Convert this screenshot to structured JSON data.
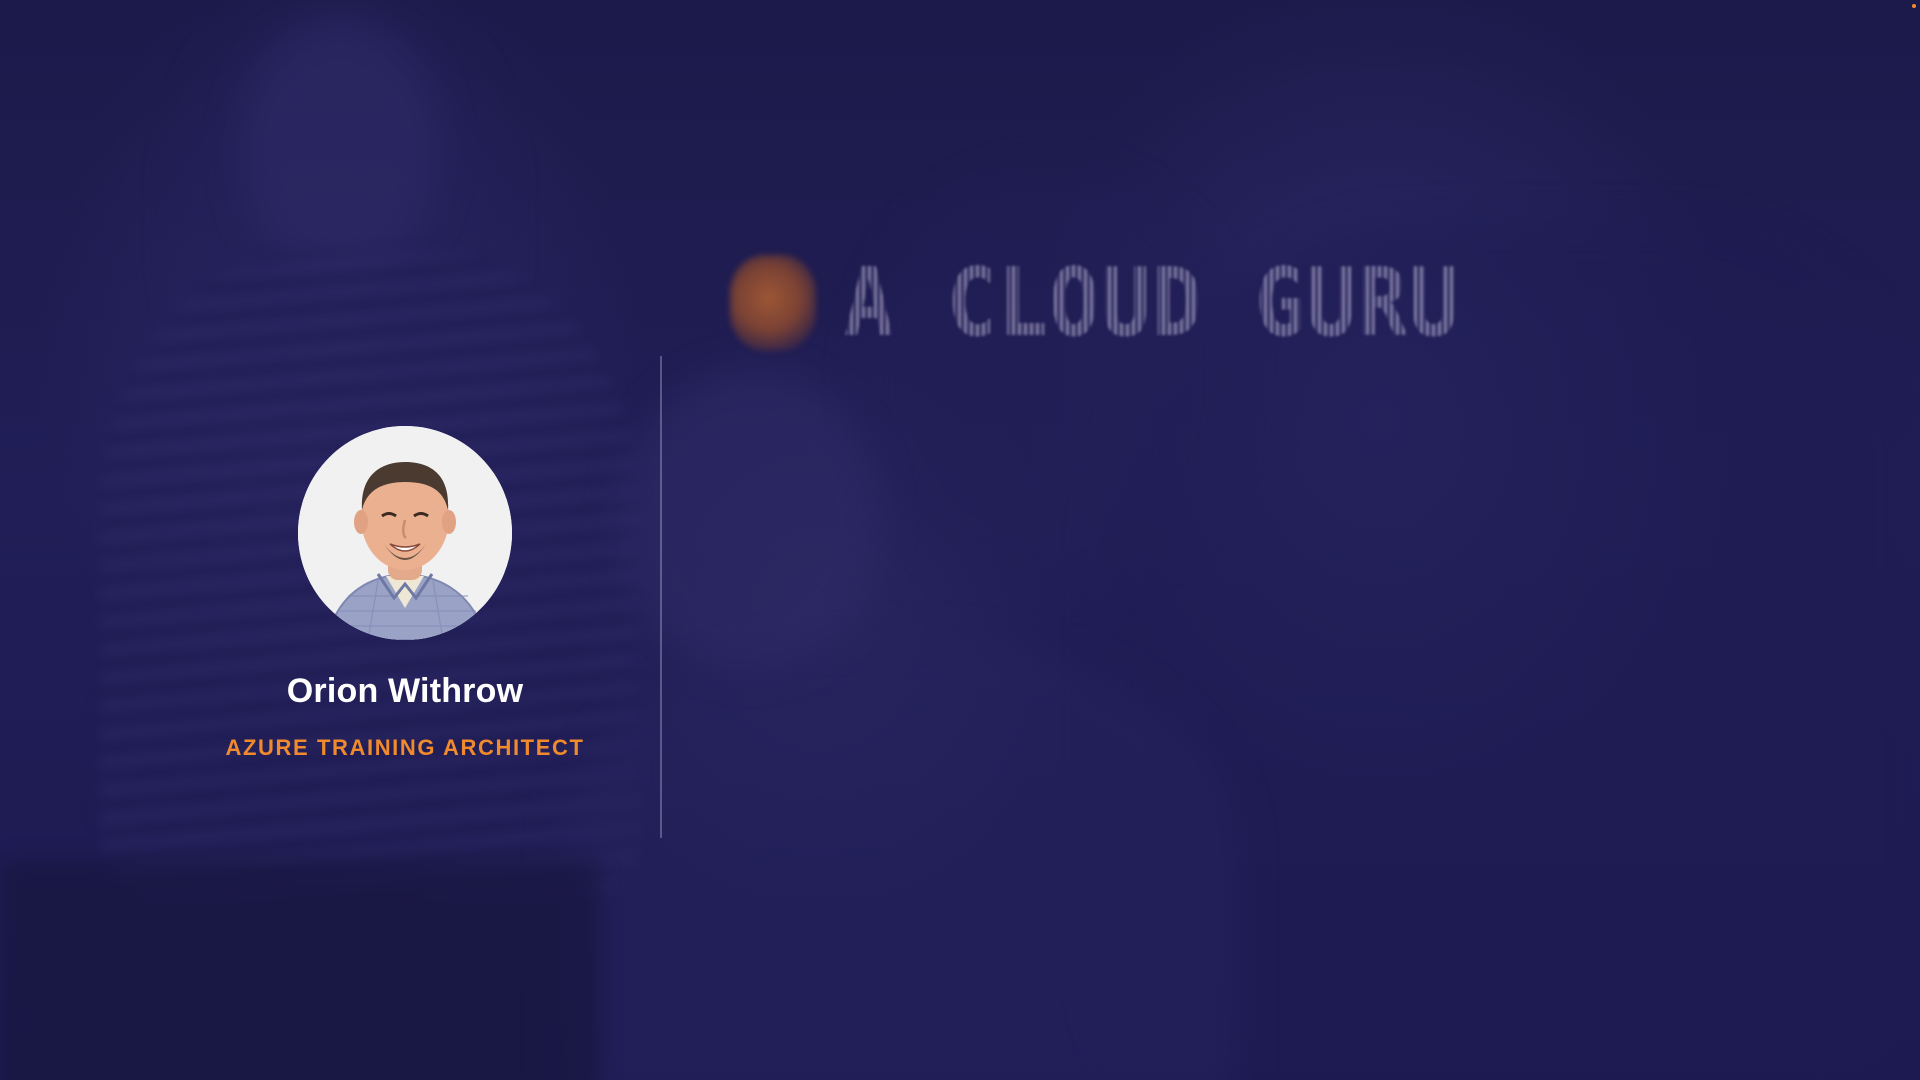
{
  "brand": {
    "logo_text": "A CLOUD GURU",
    "accent_color": "#f08a2c",
    "background_color": "#1e1b4f"
  },
  "presenter": {
    "name": "Orion Withrow",
    "title": "AZURE TRAINING ARCHITECT",
    "avatar_icon": "presenter-photo"
  }
}
